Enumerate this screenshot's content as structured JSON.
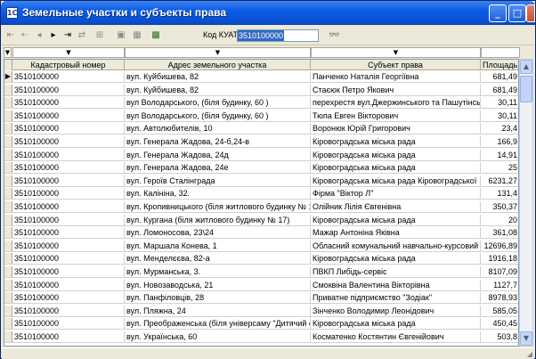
{
  "window": {
    "title": "Земельные участки и субъекты права",
    "app_icon": "1С",
    "buttons": {
      "minimize": "_",
      "maximize": "□",
      "close": "×"
    }
  },
  "toolbar": {
    "koatu_label": "Код КУАТУ",
    "koatu_value": "3510100000",
    "icons": [
      "first-icon",
      "prev-page-icon",
      "prev-icon",
      "next-icon",
      "last-icon",
      "refresh-icon",
      "filter-icon",
      "sort-icon",
      "print-icon",
      "binoculars-icon"
    ]
  },
  "filter_row": {
    "arrow": "▼"
  },
  "table": {
    "columns": [
      "Кадастровый номер",
      "Адрес земельного участка",
      "Субъект права",
      "Площадь"
    ],
    "rows": [
      [
        "3510100000",
        "вул. Куйбишева, 82",
        "Панченко Наталія Георгіївна",
        "681,49"
      ],
      [
        "3510100000",
        "вул. Куйбишева, 82",
        "Стаєюк Петро Якович",
        "681,49"
      ],
      [
        "3510100000",
        "вул Володарського, (біля будинку, 60 )",
        "перехрестя вул.Джержинського та Пашутінсь",
        "30,11"
      ],
      [
        "3510100000",
        "вул Володарського, (біля будинку, 60 )",
        "Тюпа Евген Вікторович",
        "30,11"
      ],
      [
        "3510100000",
        "вул. Автолюбителів, 10",
        "Воронюк Юрій Григорович",
        "23,4"
      ],
      [
        "3510100000",
        "вул. Генерала Жадова, 24-б,24-в",
        "Кіровоградська міська рада",
        "166,9"
      ],
      [
        "3510100000",
        "вул. Генерала Жадова, 24д",
        "Кіровоградська міська рада",
        "14,91"
      ],
      [
        "3510100000",
        "вул. Генерала Жадова, 24е",
        "Кіровоградська міська рада",
        "25"
      ],
      [
        "3510100000",
        "вул. Героїв Сталінграда",
        "Кіровоградська міська рада Кіровоградської",
        "6231,27"
      ],
      [
        "3510100000",
        "вул. Калініна, 32.",
        "Фірма \"Віктор Л\"",
        "131,4"
      ],
      [
        "3510100000",
        "вул. Кропивницького (біля житлового будинку № 18(",
        "Олійник Лілія Євгенівна",
        "350,37"
      ],
      [
        "3510100000",
        "вул. Кургана (біля житлового будинку № 17)",
        "Кіровоградська міська рада",
        "20"
      ],
      [
        "3510100000",
        "вул. Ломоносова, 23\\24",
        "Мажар Антоніна Яківна",
        "361,08"
      ],
      [
        "3510100000",
        "вул. Маршала Конева, 1",
        "Обласний комунальний навчально-курсовий к",
        "12696,89"
      ],
      [
        "3510100000",
        "вул. Менделєєва, 82-а",
        "Кіровоградська міська рада",
        "1916,18"
      ],
      [
        "3510100000",
        "вул. Мурманська, 3.",
        "ПВКП Либідь-сервіс",
        "8107,09"
      ],
      [
        "3510100000",
        "вул. Новозаводська, 21",
        "Смоквіна Валентина Вікторівна",
        "1127,7"
      ],
      [
        "3510100000",
        "вул. Панфіловців, 28",
        "Приватне підприємство \"Зодіак\"",
        "8978,93"
      ],
      [
        "3510100000",
        "вул. Пляжна, 24",
        "Зінченко Володимир Леонідович",
        "585,05"
      ],
      [
        "3510100000",
        "вул. Преображенська (біля універсаму \"Дитячий світ\")",
        "Кіровоградська міська рада",
        "450,45"
      ],
      [
        "3510100000",
        "вул. Українська, 60",
        "Косматенко Костянтин Євгенійович",
        "503,8"
      ]
    ]
  }
}
